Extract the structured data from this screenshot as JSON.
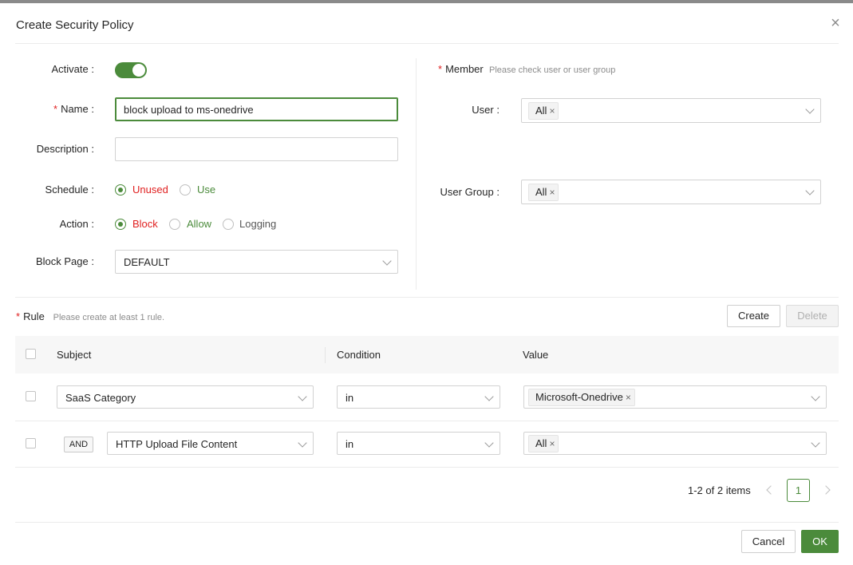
{
  "dialog": {
    "title": "Create Security Policy",
    "close_label": "×"
  },
  "form": {
    "activate_label": "Activate",
    "activate_on": true,
    "name_label": "Name",
    "name_value": "block upload to ms-onedrive",
    "description_label": "Description",
    "description_value": "",
    "schedule_label": "Schedule",
    "schedule_options": [
      "Unused",
      "Use"
    ],
    "schedule_selected": "Unused",
    "action_label": "Action",
    "action_options": [
      "Block",
      "Allow",
      "Logging"
    ],
    "action_selected": "Block",
    "block_page_label": "Block Page",
    "block_page_value": "DEFAULT",
    "colon": ":"
  },
  "member": {
    "label": "Member",
    "hint": "Please check user or user group",
    "user_label": "User",
    "user_tags": [
      "All"
    ],
    "group_label": "User Group",
    "group_tags": [
      "All"
    ]
  },
  "rule": {
    "label": "Rule",
    "hint": "Please create at least 1 rule.",
    "create_label": "Create",
    "delete_label": "Delete",
    "columns": [
      "Subject",
      "Condition",
      "Value"
    ],
    "rows": [
      {
        "connector": "",
        "subject": "SaaS Category",
        "condition": "in",
        "value_tags": [
          "Microsoft-Onedrive"
        ]
      },
      {
        "connector": "AND",
        "subject": "HTTP Upload File Content",
        "condition": "in",
        "value_tags": [
          "All"
        ]
      }
    ]
  },
  "pagination": {
    "summary": "1-2 of 2 items",
    "current_page": "1"
  },
  "footer": {
    "cancel_label": "Cancel",
    "ok_label": "OK"
  },
  "colors": {
    "accent": "#4b8b3b",
    "required": "#e02020"
  }
}
